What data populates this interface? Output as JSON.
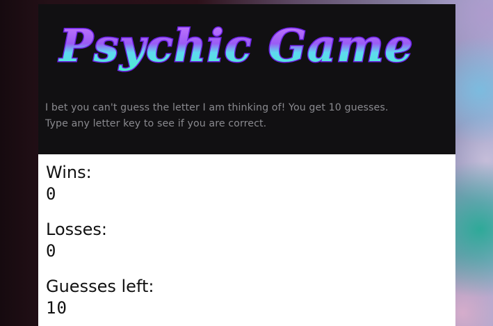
{
  "title": "Psychic Game",
  "intro": {
    "line1": "I bet you can't guess the letter I am thinking of! You get 10 guesses.",
    "line2": "Type any letter key to see if you are correct."
  },
  "stats": {
    "wins_label": "Wins:",
    "wins_value": "0",
    "losses_label": "Losses:",
    "losses_value": "0",
    "guesses_label": "Guesses left:",
    "guesses_value": "10"
  },
  "colors": {
    "header_bg": "#111012",
    "logo_fill_top": "#c56bff",
    "logo_fill_bottom": "#47f0d8",
    "logo_outline": "#6a1fe0",
    "intro_text": "#8a8a8f",
    "panel_bg": "#ffffff"
  }
}
